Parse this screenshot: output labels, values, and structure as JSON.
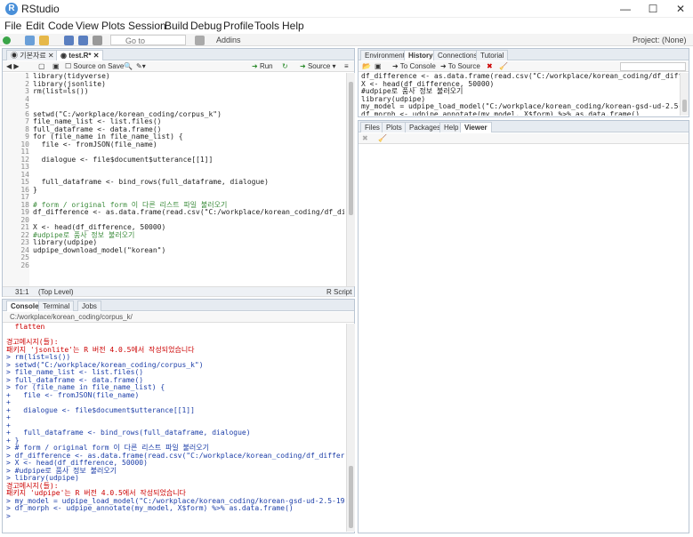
{
  "window": {
    "title": "RStudio",
    "minimize": "—",
    "maximize": "☐",
    "close": "✕"
  },
  "menu": [
    "File",
    "Edit",
    "Code",
    "View",
    "Plots",
    "Session",
    "Build",
    "Debug",
    "Profile",
    "Tools",
    "Help"
  ],
  "toolbar": {
    "goto_placeholder": "Go to file/function",
    "addins": "Addins",
    "project": "Project: (None)"
  },
  "editor": {
    "tabs": [
      "기본자료",
      "test.R*"
    ],
    "source_on_save": "Source on Save",
    "run": "Run",
    "source": "Source",
    "status_pos": "31:1",
    "status_scope": "(Top Level)",
    "status_type": "R Script",
    "line_numbers": "1\n2\n3\n4\n5\n6\n7\n8\n9\n10\n11\n12\n13\n14\n15\n16\n17\n18\n19\n20\n21\n22\n23\n24\n25\n26",
    "lines": [
      "library(tidyverse)",
      "library(jsonlite)",
      "rm(list=ls())",
      "",
      "",
      "setwd(\"C:/workplace/korean_coding/corpus_k\")",
      "file_name_list <- list.files()",
      "full_dataframe <- data.frame()",
      "for (file_name in file_name_list) {",
      "  file <- fromJSON(file_name)",
      "",
      "  dialogue <- file$document$utterance[[1]]",
      "",
      "",
      "  full_dataframe <- bind_rows(full_dataframe, dialogue)",
      "}",
      "",
      "# form / original form 이 다른 리스트 파일 불러오기",
      "df_difference <- as.data.frame(read.csv(\"C:/workplace/korean_coding/df_difference.csv\"))",
      "",
      "X <- head(df_difference, 50000)",
      "#udpipe로 품사 정보 불러오기",
      "library(udpipe)",
      "udpipe_download_model(\"korean\")",
      "",
      ""
    ]
  },
  "console": {
    "tabs": [
      "Console",
      "Terminal",
      "Jobs"
    ],
    "path": "C:/workplace/korean_coding/corpus_k/",
    "lines": [
      {
        "t": "  flatten",
        "c": "red"
      },
      {
        "t": "",
        "c": ""
      },
      {
        "t": "경고메시지(들):",
        "c": "red"
      },
      {
        "t": "패키지 'jsonlite'는 R 버전 4.0.5에서 작성되었습니다",
        "c": "red"
      },
      {
        "t": "> rm(list=ls())",
        "c": "blue"
      },
      {
        "t": "> setwd(\"C:/workplace/korean_coding/corpus_k\")",
        "c": "blue"
      },
      {
        "t": "> file_name_list <- list.files()",
        "c": "blue"
      },
      {
        "t": "> full_dataframe <- data.frame()",
        "c": "blue"
      },
      {
        "t": "> for (file_name in file_name_list) {",
        "c": "blue"
      },
      {
        "t": "+   file <- fromJSON(file_name)",
        "c": "blue"
      },
      {
        "t": "+",
        "c": "blue"
      },
      {
        "t": "+   dialogue <- file$document$utterance[[1]]",
        "c": "blue"
      },
      {
        "t": "+",
        "c": "blue"
      },
      {
        "t": "+",
        "c": "blue"
      },
      {
        "t": "+   full_dataframe <- bind_rows(full_dataframe, dialogue)",
        "c": "blue"
      },
      {
        "t": "+ }",
        "c": "blue"
      },
      {
        "t": "> # form / original form 이 다른 리스트 파일 불러오기",
        "c": "blue"
      },
      {
        "t": "> df_difference <- as.data.frame(read.csv(\"C:/workplace/korean_coding/df_difference.csv\"))",
        "c": "blue"
      },
      {
        "t": "> X <- head(df_difference, 50000)",
        "c": "blue"
      },
      {
        "t": "> #udpipe로 품사 정보 불러오기",
        "c": "blue"
      },
      {
        "t": "> library(udpipe)",
        "c": "blue"
      },
      {
        "t": "경고메시지(들):",
        "c": "red"
      },
      {
        "t": "패키지 'udpipe'는 R 버전 4.0.5에서 작성되었습니다",
        "c": "red"
      },
      {
        "t": "> my_model = udpipe_load_model(\"C:/workplace/korean_coding/korean-gsd-ud-2.5-191206.udpipe\")",
        "c": "blue"
      },
      {
        "t": "> df_morph <- udpipe_annotate(my_model, X$form) %>% as.data.frame()",
        "c": "blue"
      },
      {
        "t": ">",
        "c": "blue"
      }
    ]
  },
  "environment": {
    "tabs": [
      "Environment",
      "History",
      "Connections",
      "Tutorial"
    ],
    "to_console": "To Console",
    "to_source": "To Source",
    "lines": [
      "df_difference <- as.data.frame(read.csv(\"C:/workplace/korean_coding/df_difference.csv\"))",
      "X <- head(df_difference, 50000)",
      "#udpipe로 품사 정보 불러오기",
      "library(udpipe)",
      "my_model = udpipe_load_model(\"C:/workplace/korean_coding/korean-gsd-ud-2.5-191206.udpipe\")",
      "df_morph <- udpipe_annotate(my_model, X$form) %>% as.data.frame()"
    ]
  },
  "files": {
    "tabs": [
      "Files",
      "Plots",
      "Packages",
      "Help",
      "Viewer"
    ]
  }
}
